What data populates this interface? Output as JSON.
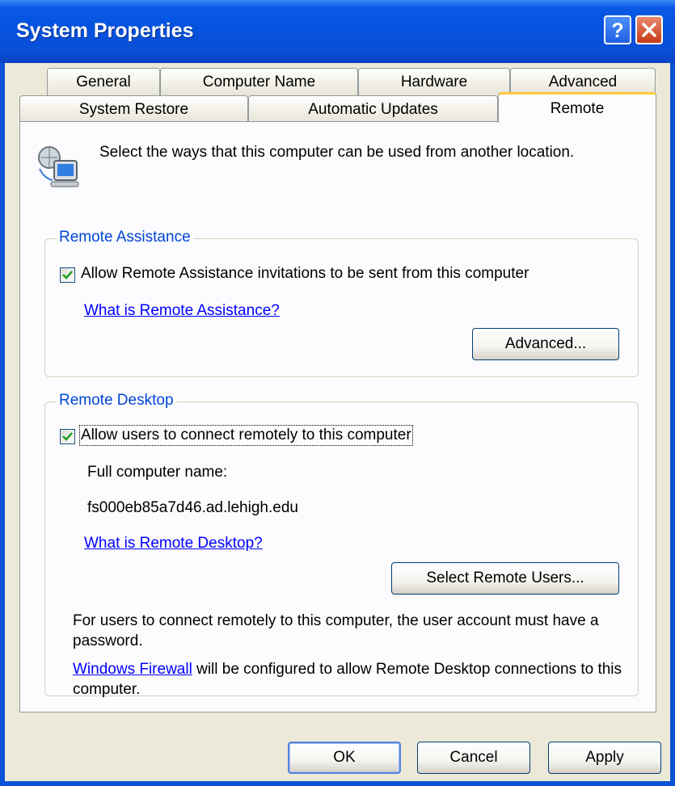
{
  "window": {
    "title": "System Properties",
    "help_icon": "question-mark",
    "close_icon": "x"
  },
  "tabs": {
    "row1": [
      "General",
      "Computer Name",
      "Hardware",
      "Advanced"
    ],
    "row2": [
      "System Restore",
      "Automatic Updates",
      "Remote"
    ],
    "active": "Remote"
  },
  "intro": {
    "icon": "remote-computer-icon",
    "text": "Select the ways that this computer can be used from another location."
  },
  "remote_assistance": {
    "group_label": "Remote Assistance",
    "checkbox_label": "Allow Remote Assistance invitations to be sent from this computer",
    "checked": true,
    "help_link": "What is Remote Assistance?",
    "advanced_button": "Advanced..."
  },
  "remote_desktop": {
    "group_label": "Remote Desktop",
    "checkbox_label": "Allow users to connect remotely to this computer",
    "checked": true,
    "full_name_label": "Full computer name:",
    "full_name_value": "fs000eb85a7d46.ad.lehigh.edu",
    "help_link": "What is Remote Desktop?",
    "select_users_button": "Select Remote Users...",
    "password_note": "For users to connect remotely to this computer, the user account must have a password.",
    "firewall_link": "Windows Firewall",
    "firewall_note": " will be configured to allow Remote Desktop connections to this computer."
  },
  "footer": {
    "ok": "OK",
    "cancel": "Cancel",
    "apply": "Apply"
  },
  "colors": {
    "titlebar": "#0453e0",
    "group_label": "#0046d5",
    "link": "#0000ff",
    "active_tab_accent": "#ffc83c",
    "check": "#21a121"
  }
}
